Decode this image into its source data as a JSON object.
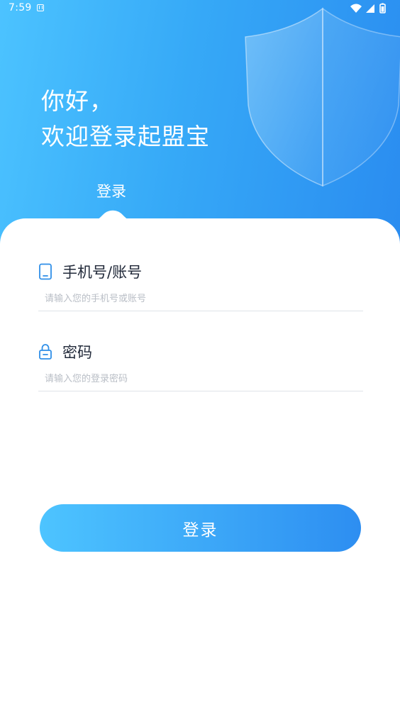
{
  "status_bar": {
    "time": "7:59",
    "notification_icon": "accessibility-icon",
    "right_icons": [
      "wifi-icon",
      "signal-icon",
      "battery-icon"
    ]
  },
  "header": {
    "greeting_line1": "你好，",
    "greeting_line2": "欢迎登录起盟宝",
    "tab_label": "登录",
    "decoration_icon": "shield-icon"
  },
  "form": {
    "account": {
      "label": "手机号/账号",
      "placeholder": "请输入您的手机号或账号",
      "value": "",
      "icon": "phone-icon"
    },
    "password": {
      "label": "密码",
      "placeholder": "请输入您的登录密码",
      "value": "",
      "icon": "lock-icon"
    },
    "submit_label": "登录"
  },
  "colors": {
    "gradient_start": "#4cc3ff",
    "gradient_end": "#2a8cf0",
    "label_text": "#222a3a",
    "placeholder": "#b9bec6",
    "divider": "#dfe3e8",
    "icon_blue": "#2f8fe8"
  }
}
